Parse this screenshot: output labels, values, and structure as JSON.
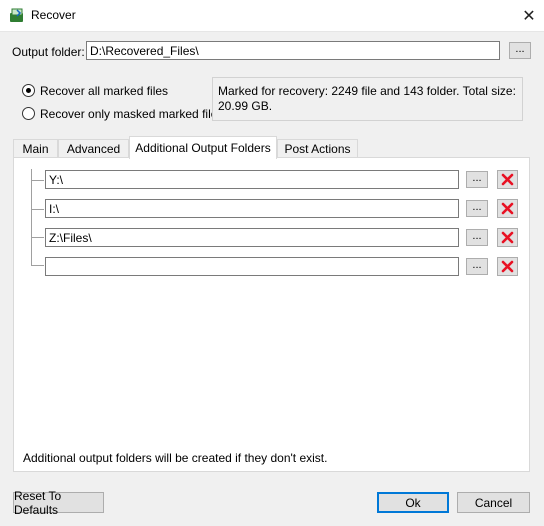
{
  "window": {
    "title": "Recover",
    "close_glyph": "✕",
    "app_icon": "recover-app-icon"
  },
  "output": {
    "label": "Output folder:",
    "value": "D:\\Recovered_Files\\",
    "browse_label": "..."
  },
  "options": {
    "recover_all_label": "Recover all marked files",
    "recover_all_checked": true,
    "recover_masked_label": "Recover only masked marked files",
    "recover_masked_checked": false
  },
  "info": {
    "text": "Marked for recovery: 2249 file and 143 folder. Total size: 20.99 GB."
  },
  "tabs": [
    {
      "label": "Main",
      "active": false
    },
    {
      "label": "Advanced",
      "active": false
    },
    {
      "label": "Additional Output Folders",
      "active": true
    },
    {
      "label": "Post Actions",
      "active": false
    }
  ],
  "additional_folders": {
    "rows": [
      {
        "value": "Y:\\",
        "browse_label": "..."
      },
      {
        "value": "I:\\",
        "browse_label": "..."
      },
      {
        "value": "Z:\\Files\\",
        "browse_label": "..."
      },
      {
        "value": "",
        "browse_label": "..."
      }
    ],
    "delete_icon": "red-x-delete-icon",
    "delete_color": "#e81123",
    "note": "Additional output folders will be created if they don't exist."
  },
  "buttons": {
    "reset": "Reset To Defaults",
    "ok": "Ok",
    "cancel": "Cancel"
  },
  "colors": {
    "accent": "#0078d7",
    "window_bg": "#f0f0f0"
  }
}
